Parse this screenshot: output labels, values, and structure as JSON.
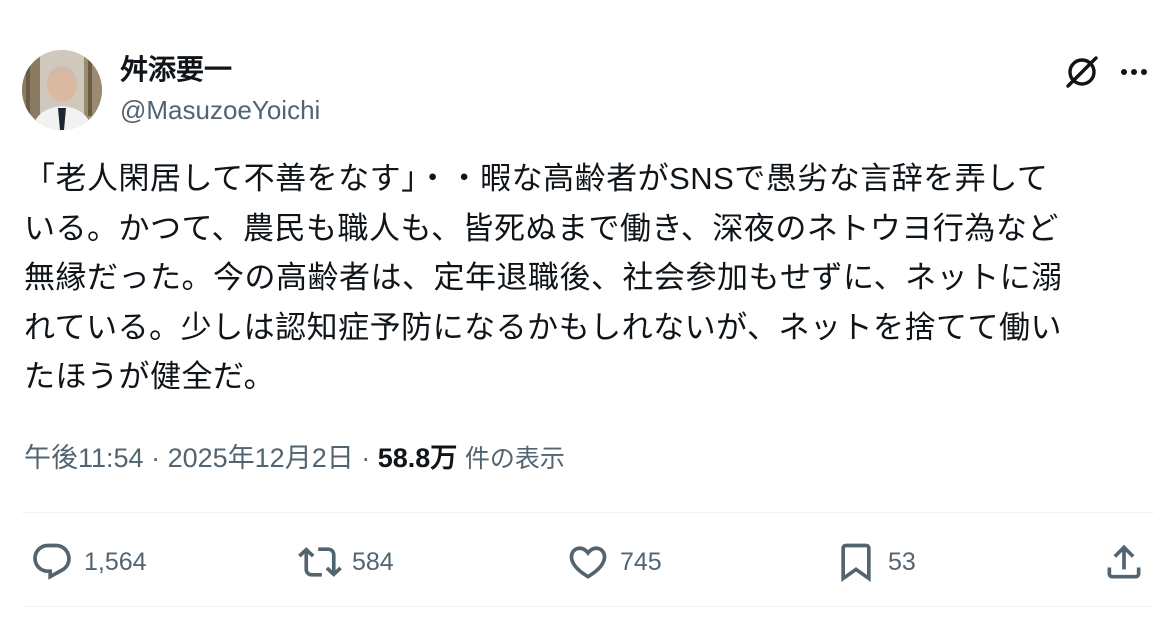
{
  "author": {
    "display_name": "舛添要一",
    "handle": "@MasuzoeYoichi",
    "avatar_icon": "profile-photo"
  },
  "header_actions": {
    "grok_icon": "grok-icon",
    "more_icon": "more-dots-icon"
  },
  "post": {
    "lines": [
      "「老人閑居して不善をなす」・・暇な高齢者がSNSで愚劣な言辞を弄して",
      "いる。かつて、農民も職人も、皆死ぬまで働き、深夜のネトウヨ行為など",
      "無縁だった。今の高齢者は、定年退職後、社会参加もせずに、ネットに溺",
      "れている。少しは認知症予防になるかもしれないが、ネットを捨てて働い",
      "たほうが健全だ。"
    ]
  },
  "meta": {
    "time": "午後11:54",
    "separator": "·",
    "date": "2025年12月2日",
    "views_count": "58.8万",
    "views_label": "件の表示"
  },
  "actions": {
    "reply": {
      "icon": "reply-icon",
      "count": "1,564"
    },
    "repost": {
      "icon": "repost-icon",
      "count": "584"
    },
    "like": {
      "icon": "heart-icon",
      "count": "745"
    },
    "bookmark": {
      "icon": "bookmark-icon",
      "count": "53"
    },
    "share": {
      "icon": "share-icon"
    }
  },
  "colors": {
    "text_primary": "#0f1419",
    "text_secondary": "#536471",
    "divider": "#eff3f4",
    "background": "#ffffff"
  }
}
